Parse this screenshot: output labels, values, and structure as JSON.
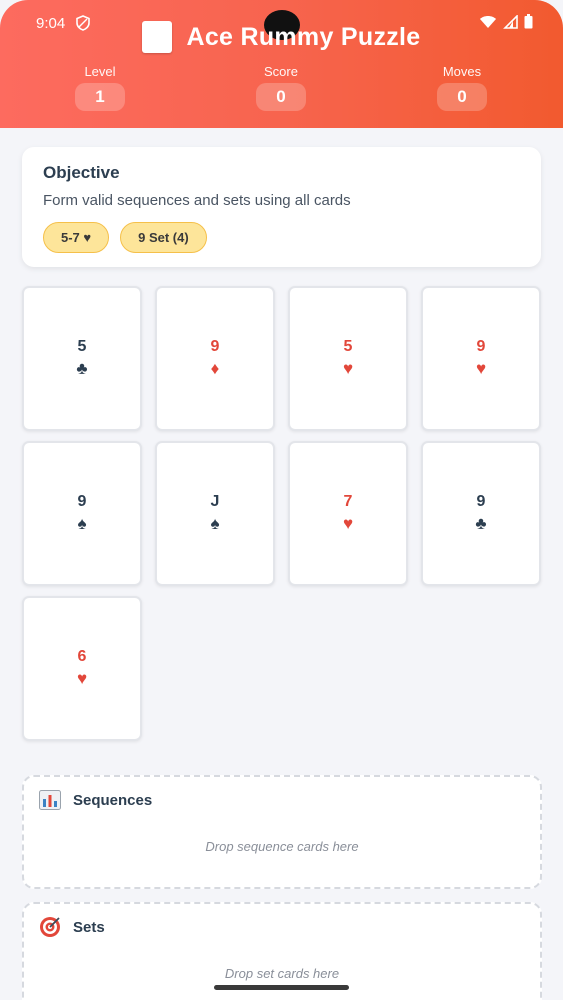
{
  "status_bar": {
    "time": "9:04"
  },
  "header": {
    "title": "Ace Rummy Puzzle",
    "stats": [
      {
        "label": "Level",
        "value": "1"
      },
      {
        "label": "Score",
        "value": "0"
      },
      {
        "label": "Moves",
        "value": "0"
      }
    ]
  },
  "objective": {
    "title": "Objective",
    "description": "Form valid sequences and sets using all cards",
    "chips": [
      "5-7 ♥",
      "9 Set (4)"
    ]
  },
  "cards": [
    {
      "rank": "5",
      "suit": "♣",
      "color": "#2c3e50"
    },
    {
      "rank": "9",
      "suit": "♦",
      "color": "#e2473a"
    },
    {
      "rank": "5",
      "suit": "♥",
      "color": "#e2473a"
    },
    {
      "rank": "9",
      "suit": "♥",
      "color": "#e2473a"
    },
    {
      "rank": "9",
      "suit": "♠",
      "color": "#2c3e50"
    },
    {
      "rank": "J",
      "suit": "♠",
      "color": "#2c3e50"
    },
    {
      "rank": "7",
      "suit": "♥",
      "color": "#e2473a"
    },
    {
      "rank": "9",
      "suit": "♣",
      "color": "#2c3e50"
    },
    {
      "rank": "6",
      "suit": "♥",
      "color": "#e2473a"
    }
  ],
  "zones": {
    "sequences": {
      "title": "Sequences",
      "hint": "Drop sequence cards here"
    },
    "sets": {
      "title": "Sets",
      "hint": "Drop set cards here"
    }
  },
  "colors": {
    "header_start": "#fd6b5f",
    "header_end": "#f25a2f",
    "chip_bg": "#fde59a",
    "red_suit": "#e2473a",
    "black_suit": "#2c3e50"
  }
}
